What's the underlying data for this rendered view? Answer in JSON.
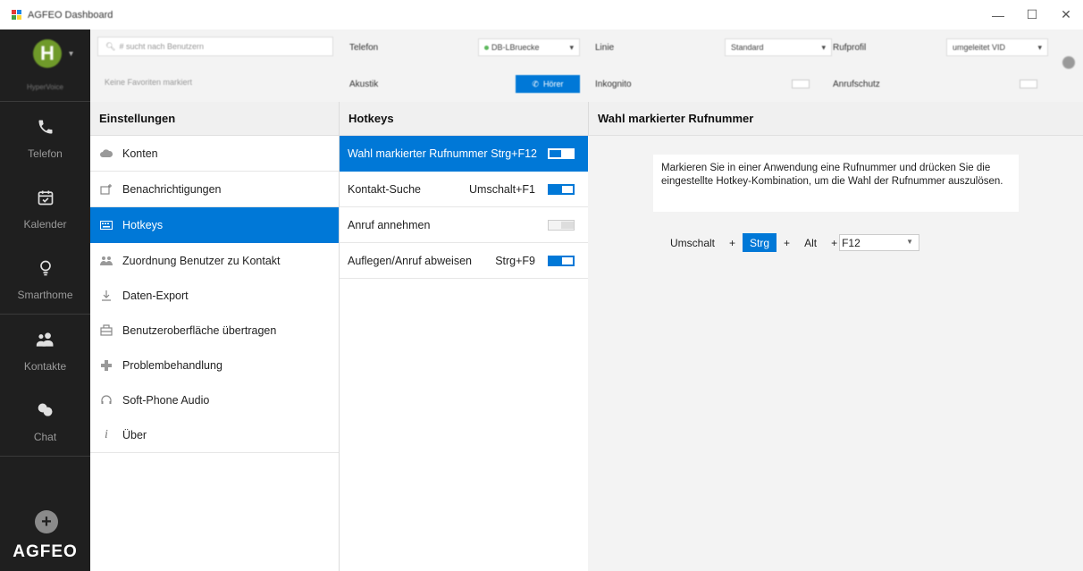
{
  "window": {
    "title": "AGFEO Dashboard",
    "controls": [
      "—",
      "☐",
      "✕"
    ]
  },
  "sidebar": {
    "avatar_letter": "H",
    "avatar_caret": "▾",
    "profile_name": "HyperVoice",
    "items": [
      {
        "label": "Telefon",
        "icon": "phone-icon"
      },
      {
        "label": "Kalender",
        "icon": "calendar-icon"
      },
      {
        "label": "Smarthome",
        "icon": "lightbulb-icon"
      },
      {
        "label": "Kontakte",
        "icon": "contacts-icon"
      },
      {
        "label": "Chat",
        "icon": "chat-icon"
      }
    ],
    "add_label": "+",
    "brand": "AGFEO"
  },
  "topbar": {
    "search_placeholder": "# sucht nach Benutzern",
    "favorites_text": "Keine Favoriten markiert",
    "telefon_label": "Telefon",
    "telefon_value": "DB-LBruecke",
    "akustik_label": "Akustik",
    "hoerer_label": "Hörer",
    "linie_label": "Linie",
    "linie_value": "Standard",
    "inkognito_label": "Inkognito",
    "rufprofil_label": "Rufprofil",
    "rufprofil_value": "umgeleitet VID",
    "anrufschutz_label": "Anrufschutz"
  },
  "settings": {
    "header": "Einstellungen",
    "items": [
      {
        "label": "Konten",
        "icon": "cloud-icon"
      },
      {
        "label": "Benachrichtigungen",
        "icon": "notification-icon"
      },
      {
        "label": "Hotkeys",
        "icon": "keyboard-icon",
        "selected": true
      },
      {
        "label": "Zuordnung Benutzer zu Kontakt",
        "icon": "user-mapping-icon"
      },
      {
        "label": "Daten-Export",
        "icon": "download-icon"
      },
      {
        "label": "Benutzeroberfläche übertragen",
        "icon": "transfer-icon"
      },
      {
        "label": "Problembehandlung",
        "icon": "medical-cross-icon"
      },
      {
        "label": "Soft-Phone Audio",
        "icon": "headset-icon"
      },
      {
        "label": "Über",
        "icon": "info-icon"
      }
    ]
  },
  "hotkeys": {
    "header": "Hotkeys",
    "items": [
      {
        "label": "Wahl markierter Rufnummer",
        "keys": "Strg+F12",
        "enabled": true,
        "selected": true
      },
      {
        "label": "Kontakt-Suche",
        "keys": "Umschalt+F1",
        "enabled": true
      },
      {
        "label": "Anruf annehmen",
        "keys": "",
        "enabled": false
      },
      {
        "label": "Auflegen/Anruf abweisen",
        "keys": "Strg+F9",
        "enabled": true
      }
    ]
  },
  "detail": {
    "header": "Wahl markierter Rufnummer",
    "description": "Markieren Sie in einer Anwendung eine Rufnummer und drücken Sie die eingestellte Hotkey-Kombination, um die Wahl der Rufnummer auszulösen.",
    "mod_umschalt": "Umschalt",
    "mod_strg": "Strg",
    "mod_alt": "Alt",
    "plus": "+",
    "key_value": "F12",
    "active_modifier": "Strg"
  },
  "colors": {
    "accent": "#0078d7",
    "sidebar_bg": "#1f1f1f",
    "avatar_green": "#6f9a2a"
  }
}
